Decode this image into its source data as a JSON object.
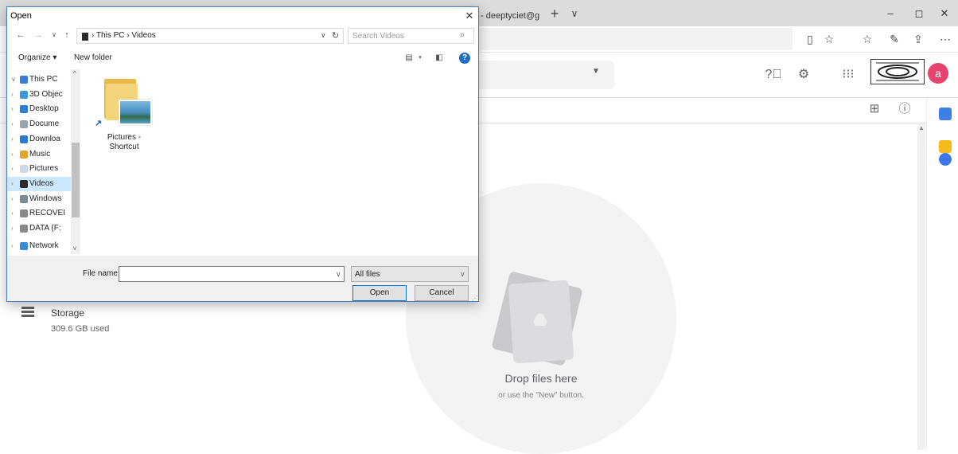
{
  "browser": {
    "tab_title": "- deeptyciet@g",
    "new_tab_icon": "+",
    "tab_list_icon": "∨",
    "minimize": "–",
    "maximize": "◻",
    "close": "✕",
    "toolbar_icons": [
      "reading-view-icon",
      "favorite-star-icon",
      "favorites-list-icon",
      "pen-icon",
      "share-icon",
      "more-icon"
    ]
  },
  "drive": {
    "storage_label": "Storage",
    "storage_used": "309.6 GB used",
    "drop_title": "Drop files here",
    "drop_subtitle": "or use the \"New\" button.",
    "avatar_letter": "a",
    "avatar_color": "#e8426e"
  },
  "dialog": {
    "title": "Open",
    "close_glyph": "✕",
    "path_text": "› This PC › Videos",
    "search_placeholder": "Search Videos",
    "organize_label": "Organize ▾",
    "new_folder_label": "New folder",
    "help_glyph": "?",
    "tree": [
      {
        "label": "This PC",
        "chev": "∨",
        "color": "#3a7bd5",
        "selected": false
      },
      {
        "label": "3D Objec",
        "chev": "›",
        "color": "#3a9ad9",
        "selected": false
      },
      {
        "label": "Desktop",
        "chev": "›",
        "color": "#2b7fd1",
        "selected": false
      },
      {
        "label": "Docume",
        "chev": "›",
        "color": "#9aa4b0",
        "selected": false
      },
      {
        "label": "Downloa",
        "chev": "›",
        "color": "#2a7ad0",
        "selected": false
      },
      {
        "label": "Music",
        "chev": "›",
        "color": "#e0a52a",
        "selected": false
      },
      {
        "label": "Pictures",
        "chev": "›",
        "color": "#c9d9e8",
        "selected": false
      },
      {
        "label": "Videos",
        "chev": "›",
        "color": "#2b2b2b",
        "selected": true
      },
      {
        "label": "Windows",
        "chev": "›",
        "color": "#7a8a96",
        "selected": false
      },
      {
        "label": "RECOVEI",
        "chev": "›",
        "color": "#8a8a8a",
        "selected": false
      },
      {
        "label": "DATA (F:",
        "chev": "›",
        "color": "#8a8a8a",
        "selected": false
      },
      {
        "label": "Network",
        "chev": "›",
        "color": "#3a8ad5",
        "selected": false
      }
    ],
    "file_item": {
      "line1": "Pictures -",
      "line2": "Shortcut"
    },
    "file_name_label": "File name:",
    "file_name_value": "",
    "filter_value": "All files",
    "open_label": "Open",
    "cancel_label": "Cancel"
  }
}
